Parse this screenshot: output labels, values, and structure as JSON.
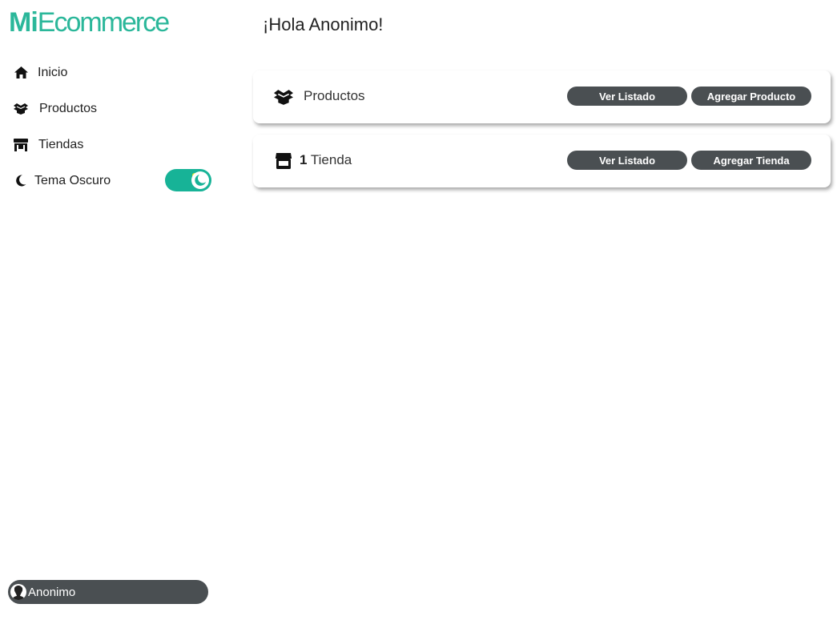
{
  "logo": {
    "strong": "Mi",
    "light": "Ecommerce"
  },
  "sidebar": {
    "items": [
      {
        "label": "Inicio",
        "icon": "home-icon"
      },
      {
        "label": "Productos",
        "icon": "box-open-icon"
      },
      {
        "label": "Tiendas",
        "icon": "store-icon"
      },
      {
        "label": "Tema Oscuro",
        "icon": "moon-icon"
      }
    ],
    "dark_theme_toggle": {
      "on": true
    }
  },
  "user": {
    "name": "Anonimo",
    "icon": "user-avatar-icon"
  },
  "main": {
    "greeting": "¡Hola Anonimo!",
    "cards": [
      {
        "icon": "box-open-icon",
        "count": "",
        "label": "Productos",
        "list_button": "Ver Listado",
        "add_button": "Agregar Producto"
      },
      {
        "icon": "store-icon",
        "count": "1",
        "label": "Tienda",
        "list_button": "Ver Listado",
        "add_button": "Agregar Tienda"
      }
    ]
  },
  "colors": {
    "accent": "#17b397",
    "logo": "#2bb79a",
    "button": "#4a4f52",
    "star": "#f2ea2b"
  }
}
